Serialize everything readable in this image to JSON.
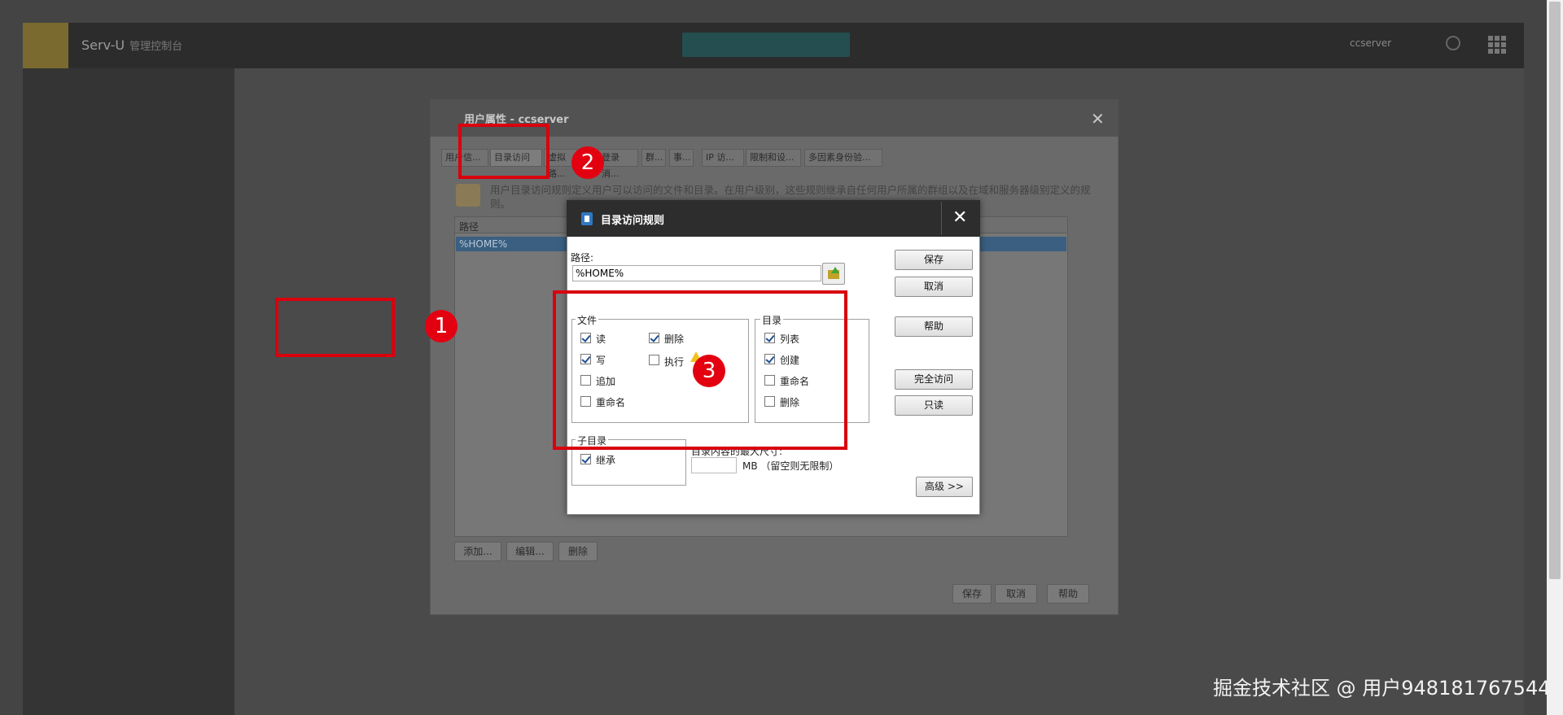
{
  "background_app": {
    "title": "Serv-U",
    "title_sub": "管理控制台",
    "user_label": "ccserver"
  },
  "props_dialog": {
    "title": "用户属性 - ccserver",
    "tabs": [
      "用户信...",
      "目录访问",
      "虚拟路...",
      "登录消...",
      "群...",
      "事...",
      "IP 访...",
      "限制和设...",
      "多因素身份验..."
    ],
    "description": "用户目录访问规则定义用户可以访问的文件和目录。在用户级别，这些规则继承自任何用户所属的群组以及在域和服务器级别定义的规则。",
    "list_column_path": "路径",
    "list_row_path": "%HOME%",
    "add_button": "添加...",
    "edit_button": "编辑...",
    "delete_button": "删除",
    "save_button": "保存",
    "cancel_button": "取消",
    "help_button": "帮助"
  },
  "rule_dialog": {
    "title": "目录访问规则",
    "path_label": "路径:",
    "path_value": "%HOME%",
    "buttons": {
      "save": "保存",
      "cancel": "取消",
      "help": "帮助",
      "full_access": "完全访问",
      "read_only": "只读",
      "advanced": "高级 >>"
    },
    "files_group": {
      "label": "文件",
      "read": "读",
      "write": "写",
      "append": "追加",
      "rename": "重命名",
      "delete": "删除",
      "execute": "执行"
    },
    "dirs_group": {
      "label": "目录",
      "list": "列表",
      "create": "创建",
      "rename": "重命名",
      "delete": "删除"
    },
    "subdir_group": {
      "label": "子目录",
      "inherit": "继承"
    },
    "maxsize_label": "目录内容的最大尺寸:",
    "maxsize_unit": "MB （留空则无限制）"
  },
  "annotations": {
    "badge1": "1",
    "badge2": "2",
    "badge3": "3"
  },
  "watermark": "掘金技术社区 @ 用户948181767544",
  "colors": {
    "annotation_red": "#d9000d",
    "dialog_header": "#2d2d2d"
  }
}
